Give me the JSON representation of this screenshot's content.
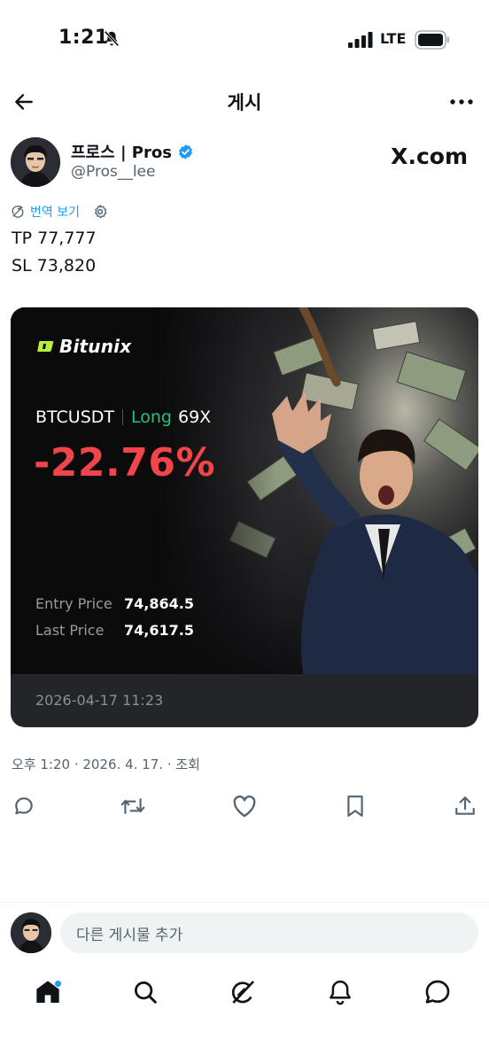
{
  "status_bar": {
    "time": "1:21",
    "network": "LTE",
    "icons": [
      "bell-slash-icon",
      "signal-icon",
      "battery-icon"
    ]
  },
  "header": {
    "title": "게시",
    "back_icon": "arrow-left-icon",
    "more_icon": "more-horizontal-icon"
  },
  "author": {
    "name": "프로스 | Pros",
    "handle": "@Pros__lee",
    "verified": true,
    "site_logo": "X.com"
  },
  "translate": {
    "label": "번역 보기"
  },
  "tweet": {
    "lines": [
      "TP 77,777",
      "SL 73,820"
    ]
  },
  "card": {
    "brand": "Bitunix",
    "pair": "BTCUSDT",
    "side": "Long",
    "leverage": "69X",
    "pnl": "-22.76%",
    "entry_label": "Entry Price",
    "entry_value": "74,864.5",
    "last_label": "Last Price",
    "last_value": "74,617.5",
    "date": "2026-04-17 11:23",
    "colors": {
      "loss": "#f1454b",
      "long": "#25c07f",
      "brand_accent": "#b6f03a"
    }
  },
  "meta": {
    "text": "오후 1:20 · 2026. 4. 17. · 조회"
  },
  "actions": [
    "reply-icon",
    "retweet-icon",
    "like-icon",
    "bookmark-icon",
    "share-icon"
  ],
  "reply_bar": {
    "placeholder": "다른 게시물 추가"
  },
  "bottom_nav": [
    "home-icon",
    "search-icon",
    "grok-icon",
    "notifications-icon",
    "messages-icon"
  ],
  "colors": {
    "accent": "#1d9bf0",
    "text": "#0f1419",
    "secondary": "#536471"
  }
}
